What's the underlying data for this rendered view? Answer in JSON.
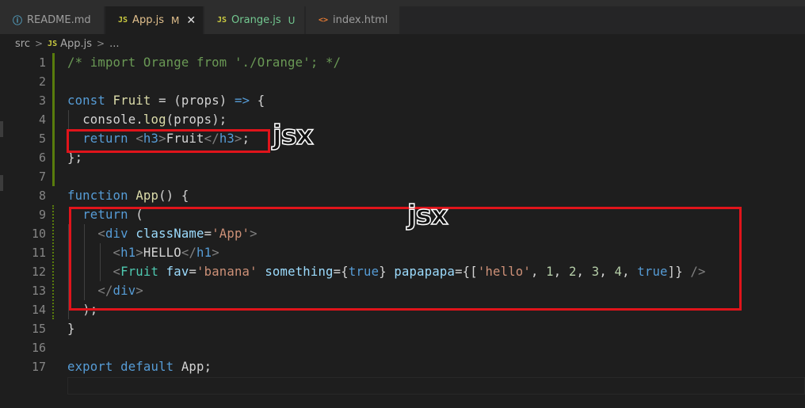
{
  "tabs": [
    {
      "icon": "ⓘ",
      "label": "README.md",
      "status": ""
    },
    {
      "icon": "JS",
      "label": "App.js",
      "status": "M",
      "close": "✕"
    },
    {
      "icon": "JS",
      "label": "Orange.js",
      "status": "U"
    },
    {
      "icon": "<>",
      "label": "index.html",
      "status": ""
    }
  ],
  "breadcrumb": {
    "folder": "src",
    "sep": ">",
    "file_icon": "JS",
    "file": "App.js",
    "tail": "..."
  },
  "lines": [
    "1",
    "2",
    "3",
    "4",
    "5",
    "6",
    "7",
    "8",
    "9",
    "10",
    "11",
    "12",
    "13",
    "14",
    "15",
    "16",
    "17"
  ],
  "code_text": {
    "l1": "/* import Orange from './Orange'; */",
    "l3_kw": "const",
    "l3_name": "Fruit",
    "l3_rest": " = (props) ",
    "l3_arrow": "=>",
    "l3_brace": " {",
    "l4_obj": "console",
    "l4_fn": "log",
    "l4_arg": "props",
    "l5_kw": "return",
    "l5_open": "h3",
    "l5_text": "Fruit",
    "l5_close": "h3",
    "l6": "};",
    "l8_kw": "function",
    "l8_name": "App",
    "l8_rest": "() {",
    "l9_kw": "return",
    "l9_rest": " (",
    "l10_tag": "div",
    "l10_attr": "className",
    "l10_val": "'App'",
    "l11_tag": "h1",
    "l11_text": "HELLO",
    "l12_tag": "Fruit",
    "l12_a1": "fav",
    "l12_v1": "'banana'",
    "l12_a2": "something",
    "l12_v2": "true",
    "l12_a3": "papapapa",
    "l12_s": "'hello'",
    "l12_n1": "1",
    "l12_n2": "2",
    "l12_n3": "3",
    "l12_n4": "4",
    "l12_t": "true",
    "l13_tag": "div",
    "l14": ");",
    "l15": "}",
    "l17_kw1": "export",
    "l17_kw2": "default",
    "l17_name": "App",
    "l17_semi": ";"
  },
  "annotations": {
    "jsx1": "jsx",
    "jsx2": "jsx"
  },
  "colors": {
    "keyword": "#569cd6",
    "function": "#dcdcaa",
    "comment": "#6a9955",
    "string": "#ce9178",
    "attribute": "#9cdcfe",
    "annotation_box": "#e0141b"
  }
}
